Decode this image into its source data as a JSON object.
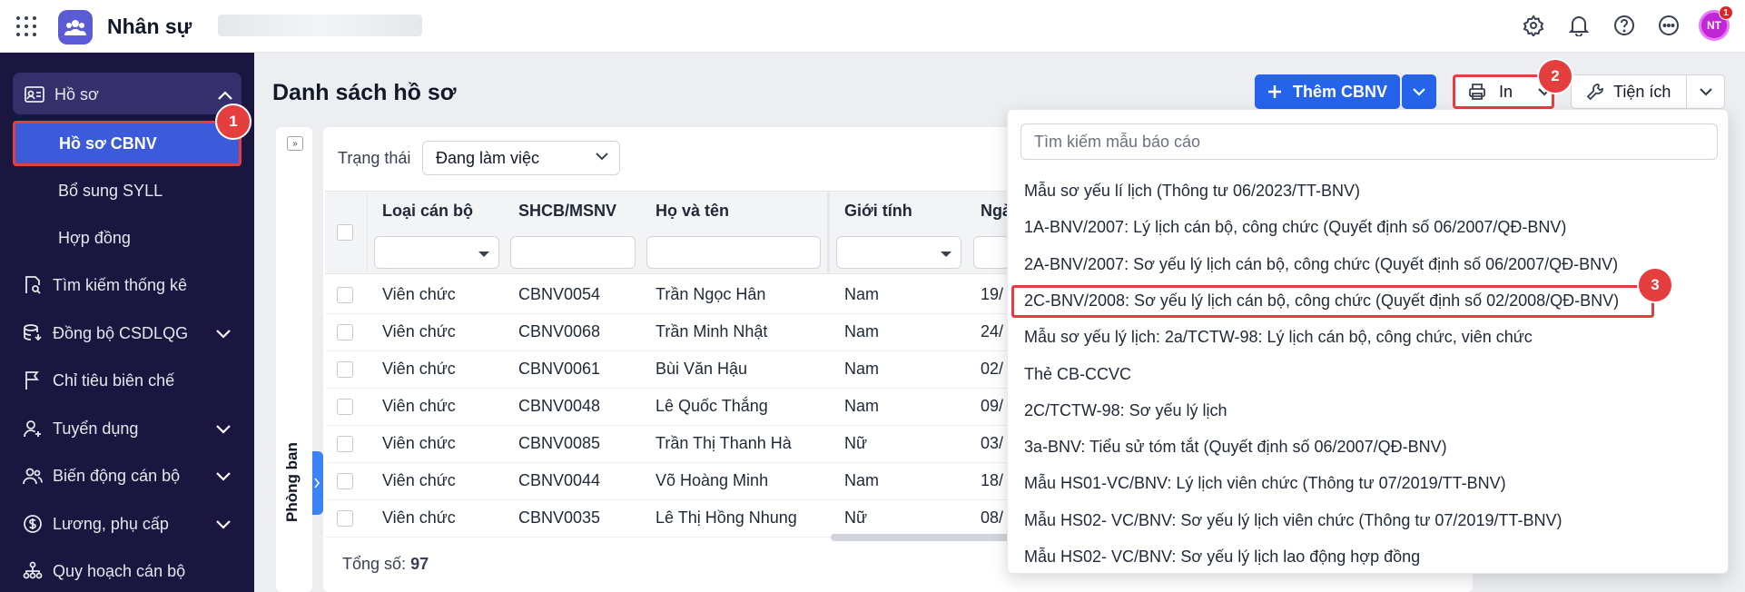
{
  "topbar": {
    "app_title": "Nhân sự",
    "avatar_initials": "NT",
    "notification_count": "1"
  },
  "sidebar": {
    "group_label": "Hồ sơ",
    "active_item": "Hồ sơ CBNV",
    "sub_items": [
      "Bổ sung SYLL",
      "Hợp đồng"
    ],
    "items": [
      {
        "label": "Tìm kiếm thống kê",
        "icon": "search-doc-icon",
        "has_chevron": false
      },
      {
        "label": "Đồng bộ CSDLQG",
        "icon": "sync-icon",
        "has_chevron": true
      },
      {
        "label": "Chỉ tiêu biên chế",
        "icon": "flag-icon",
        "has_chevron": false
      },
      {
        "label": "Tuyển dụng",
        "icon": "user-plus-icon",
        "has_chevron": true
      },
      {
        "label": "Biến động cán bộ",
        "icon": "users-icon",
        "has_chevron": true
      },
      {
        "label": "Lương, phụ cấp",
        "icon": "money-icon",
        "has_chevron": true
      },
      {
        "label": "Quy hoạch cán bộ",
        "icon": "org-chart-icon",
        "has_chevron": false
      }
    ]
  },
  "main": {
    "title": "Danh sách hồ sơ",
    "add_button": "Thêm CBNV",
    "print_button": "In",
    "utility_button": "Tiện ích",
    "department_panel": "Phòng ban",
    "status_label": "Trạng thái",
    "status_value": "Đang làm việc",
    "total_label": "Tổng số:",
    "total_value": "97"
  },
  "table": {
    "columns": [
      "Loại cán bộ",
      "SHCB/MSNV",
      "Họ và tên",
      "Giới tính",
      "Ngà"
    ],
    "rows": [
      [
        "Viên chức",
        "CBNV0054",
        "Trần Ngọc Hân",
        "Nam",
        "19/"
      ],
      [
        "Viên chức",
        "CBNV0068",
        "Trần Minh Nhật",
        "Nam",
        "24/"
      ],
      [
        "Viên chức",
        "CBNV0061",
        "Bùi Văn Hậu",
        "Nam",
        "02/"
      ],
      [
        "Viên chức",
        "CBNV0048",
        "Lê Quốc Thắng",
        "Nam",
        "09/"
      ],
      [
        "Viên chức",
        "CBNV0085",
        "Trần Thị Thanh Hà",
        "Nữ",
        "03/"
      ],
      [
        "Viên chức",
        "CBNV0044",
        "Võ Hoàng Minh",
        "Nam",
        "18/"
      ],
      [
        "Viên chức",
        "CBNV0035",
        "Lê Thị Hồng Nhung",
        "Nữ",
        "08/"
      ]
    ]
  },
  "dropdown": {
    "search_placeholder": "Tìm kiếm mẫu báo cáo",
    "items": [
      "Mẫu sơ yếu lí lịch (Thông tư 06/2023/TT-BNV)",
      "1A-BNV/2007: Lý lịch cán bộ, công chức (Quyết định số 06/2007/QĐ-BNV)",
      "2A-BNV/2007: Sơ yếu lý lịch cán bộ, công chức (Quyết định số 06/2007/QĐ-BNV)",
      "2C-BNV/2008: Sơ yếu lý lịch cán bộ, công chức (Quyết định số 02/2008/QĐ-BNV)",
      "Mẫu sơ yếu lý lịch: 2a/TCTW-98: Lý lịch cán bộ, công chức, viên chức",
      "Thẻ CB-CCVC",
      "2C/TCTW-98: Sơ yếu lý lịch",
      "3a-BNV: Tiểu sử tóm tắt (Quyết định số 06/2007/QĐ-BNV)",
      "Mẫu HS01-VC/BNV: Lý lịch viên chức (Thông tư 07/2019/TT-BNV)",
      "Mẫu HS02- VC/BNV: Sơ yếu lý lịch viên chức (Thông tư 07/2019/TT-BNV)",
      "Mẫu HS02- VC/BNV: Sơ yếu lý lịch lao động hợp đồng"
    ]
  },
  "markers": [
    "1",
    "2",
    "3"
  ],
  "colors": {
    "sidebar_bg": "#1a1640",
    "accent": "#2563eb",
    "highlight": "#e53e3e"
  }
}
